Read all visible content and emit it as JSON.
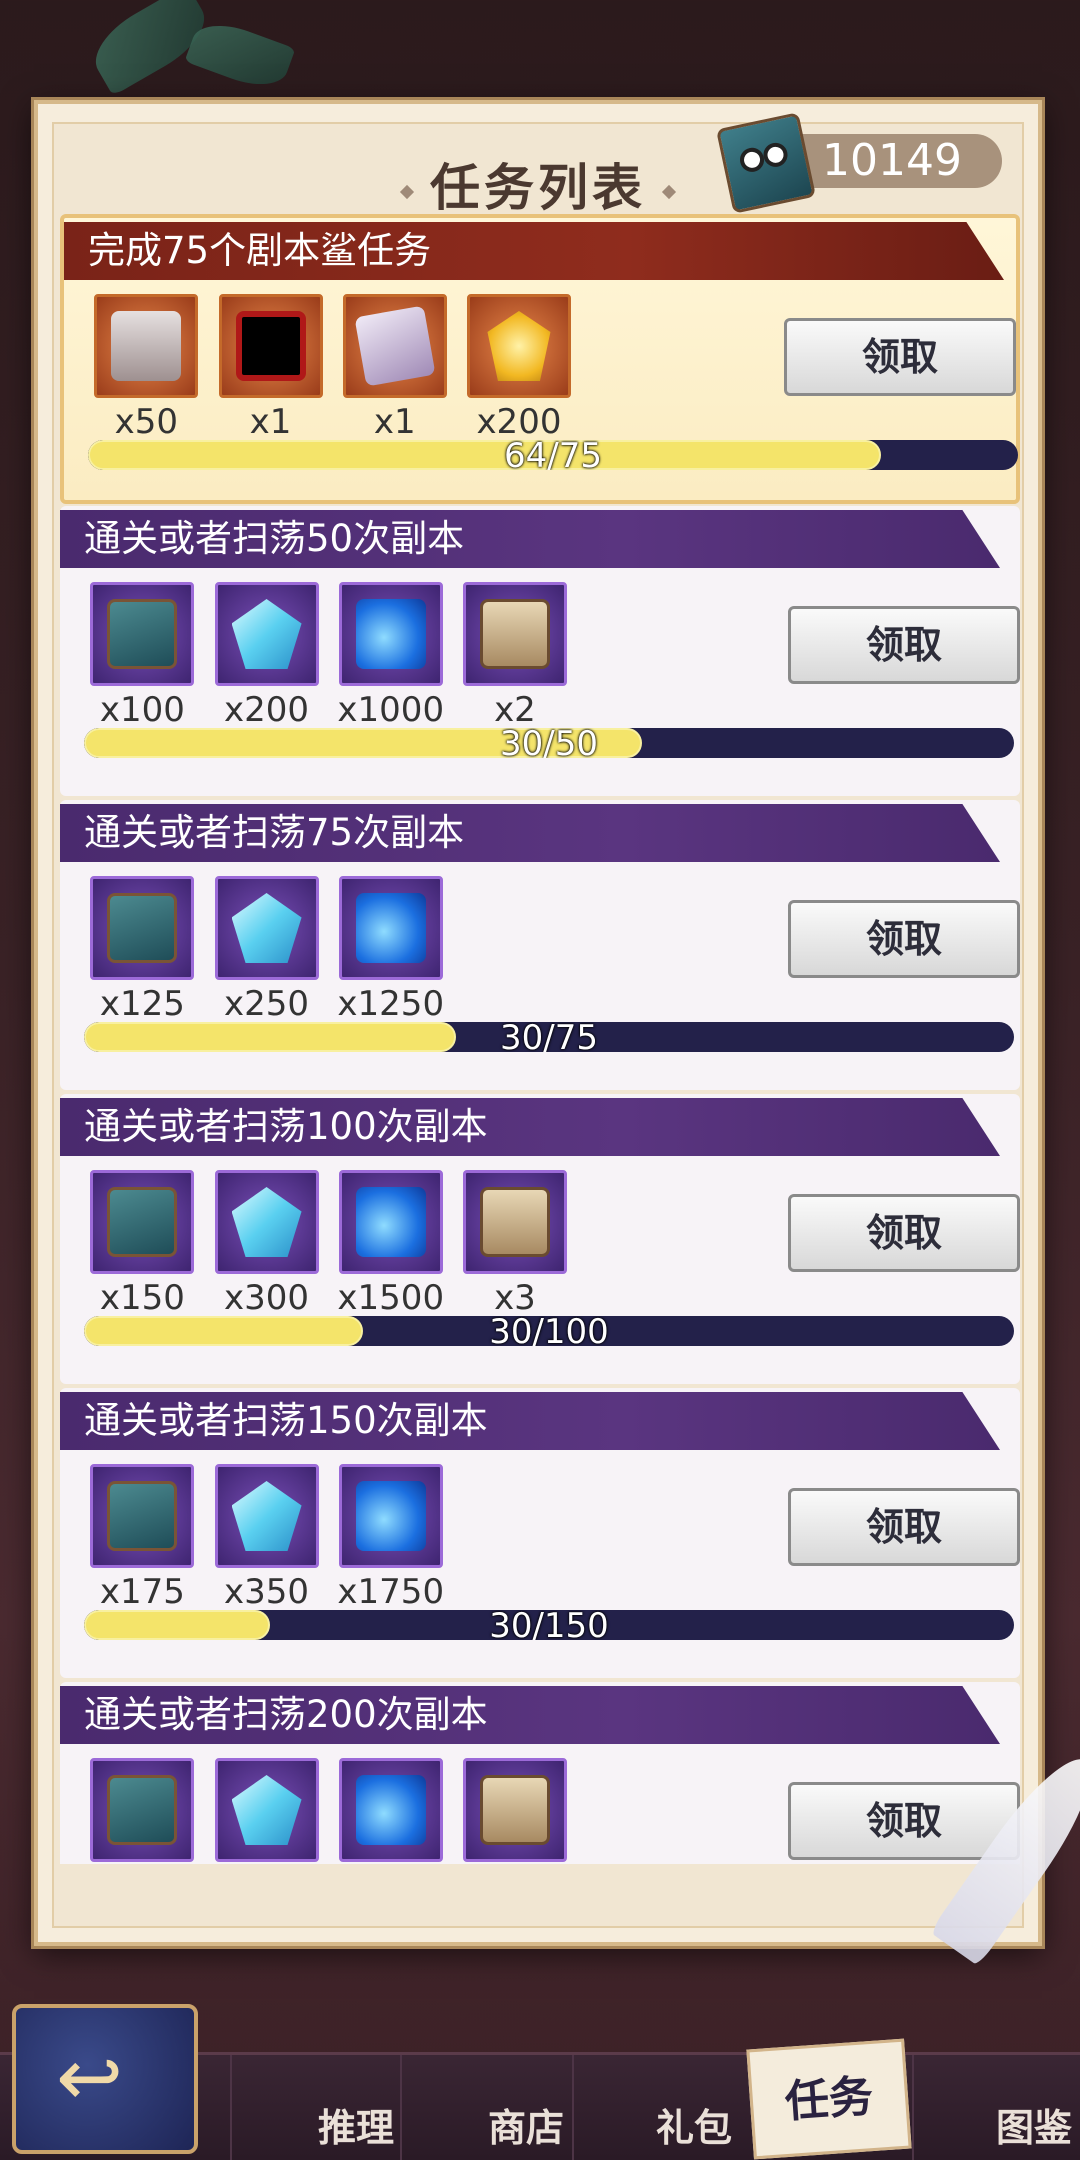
{
  "header": {
    "title": "任务列表",
    "currency_icon": "book-icon",
    "currency_value": "10149"
  },
  "tasks": [
    {
      "title": "完成75个剧本鲨任务",
      "style": "red",
      "rewards": [
        {
          "icon": "character-card-icon",
          "qty": "x50"
        },
        {
          "icon": "avatar-frame-icon",
          "qty": "x1"
        },
        {
          "icon": "card-pack-icon",
          "qty": "x1"
        },
        {
          "icon": "gold-gem-icon",
          "qty": "x200"
        }
      ],
      "progress_text": "64/75",
      "progress": 0.853,
      "claim_label": "领取"
    },
    {
      "title": "通关或者扫荡50次副本",
      "style": "purple",
      "rewards": [
        {
          "icon": "book-icon",
          "qty": "x100"
        },
        {
          "icon": "crystal-icon",
          "qty": "x200"
        },
        {
          "icon": "potion-icon",
          "qty": "x1000"
        },
        {
          "icon": "portrait-card-icon",
          "qty": "x2"
        }
      ],
      "progress_text": "30/50",
      "progress": 0.6,
      "claim_label": "领取"
    },
    {
      "title": "通关或者扫荡75次副本",
      "style": "purple",
      "rewards": [
        {
          "icon": "book-icon",
          "qty": "x125"
        },
        {
          "icon": "crystal-icon",
          "qty": "x250"
        },
        {
          "icon": "potion-icon",
          "qty": "x1250"
        }
      ],
      "progress_text": "30/75",
      "progress": 0.4,
      "claim_label": "领取"
    },
    {
      "title": "通关或者扫荡100次副本",
      "style": "purple",
      "rewards": [
        {
          "icon": "book-icon",
          "qty": "x150"
        },
        {
          "icon": "crystal-icon",
          "qty": "x300"
        },
        {
          "icon": "potion-icon",
          "qty": "x1500"
        },
        {
          "icon": "portrait-card-icon",
          "qty": "x3"
        }
      ],
      "progress_text": "30/100",
      "progress": 0.3,
      "claim_label": "领取"
    },
    {
      "title": "通关或者扫荡150次副本",
      "style": "purple",
      "rewards": [
        {
          "icon": "book-icon",
          "qty": "x175"
        },
        {
          "icon": "crystal-icon",
          "qty": "x350"
        },
        {
          "icon": "potion-icon",
          "qty": "x1750"
        }
      ],
      "progress_text": "30/150",
      "progress": 0.2,
      "claim_label": "领取"
    },
    {
      "title": "通关或者扫荡200次副本",
      "style": "purple",
      "rewards": [
        {
          "icon": "book-icon",
          "qty": ""
        },
        {
          "icon": "crystal-icon",
          "qty": ""
        },
        {
          "icon": "potion-icon",
          "qty": ""
        },
        {
          "icon": "portrait-card-icon",
          "qty": ""
        }
      ],
      "progress_text": "",
      "progress": 0,
      "claim_label": "领取"
    }
  ],
  "nav": {
    "back_icon": "back-arrow-icon",
    "items": [
      "推理",
      "商店",
      "礼包",
      "任务",
      "图鉴"
    ],
    "active": "任务"
  }
}
